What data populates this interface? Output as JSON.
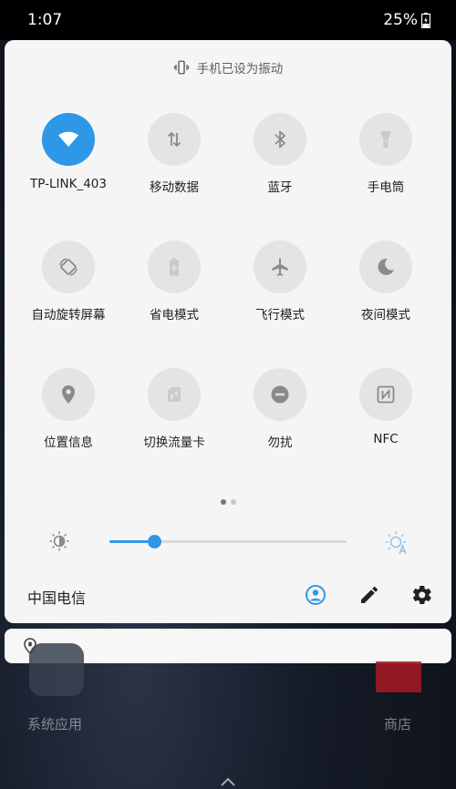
{
  "status_bar": {
    "time": "1:07",
    "battery": "25%"
  },
  "panel": {
    "vibrate_text": "手机已设为振动",
    "tiles": [
      {
        "label": "TP-LINK_403",
        "icon": "wifi-icon",
        "active": true
      },
      {
        "label": "移动数据",
        "icon": "mobile-data-icon",
        "active": false
      },
      {
        "label": "蓝牙",
        "icon": "bluetooth-icon",
        "active": false
      },
      {
        "label": "手电筒",
        "icon": "flashlight-icon",
        "active": false
      },
      {
        "label": "自动旋转屏幕",
        "icon": "auto-rotate-icon",
        "active": false
      },
      {
        "label": "省电模式",
        "icon": "battery-saver-icon",
        "active": false
      },
      {
        "label": "飞行模式",
        "icon": "airplane-icon",
        "active": false
      },
      {
        "label": "夜间模式",
        "icon": "moon-icon",
        "active": false
      },
      {
        "label": "位置信息",
        "icon": "location-icon",
        "active": false
      },
      {
        "label": "切换流量卡",
        "icon": "sim-switch-icon",
        "active": false
      },
      {
        "label": "勿扰",
        "icon": "do-not-disturb-icon",
        "active": false
      },
      {
        "label": "NFC",
        "icon": "nfc-icon",
        "active": false
      }
    ],
    "page_indicator": {
      "current": 1,
      "total": 2
    },
    "brightness_level": 0.19,
    "carrier": "中国电信"
  },
  "home": {
    "app1_label": "系统应用",
    "app2_label": "商店"
  },
  "colors": {
    "accent": "#2e97e8",
    "panel_bg": "#f5f5f5",
    "tile_bg": "#e4e4e4"
  }
}
